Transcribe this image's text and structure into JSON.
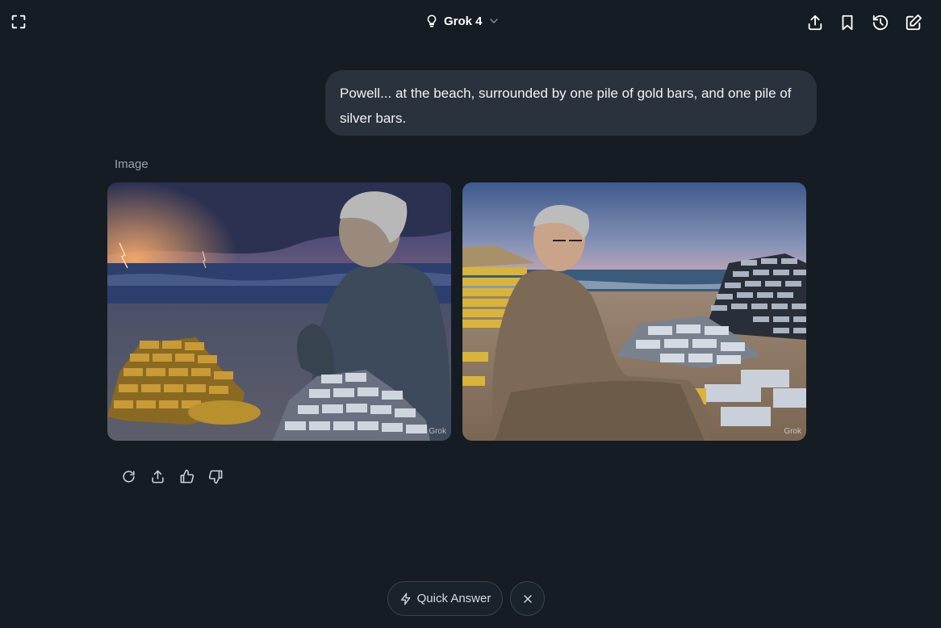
{
  "header": {
    "model_name": "Grok 4"
  },
  "conversation": {
    "user_message": "Powell... at the beach, surrounded by one pile of gold bars, and one pile of silver bars.",
    "response_label": "Image",
    "images": [
      {
        "watermark": "Grok"
      },
      {
        "watermark": "Grok"
      }
    ]
  },
  "bottom_bar": {
    "quick_answer_label": "Quick Answer"
  },
  "icons": {
    "expand": "expand-icon",
    "model": "lightbulb-icon",
    "share": "share-icon",
    "bookmark": "bookmark-icon",
    "history": "history-icon",
    "edit": "edit-icon",
    "regenerate": "refresh-icon",
    "thumbs_up": "thumbs-up-icon",
    "thumbs_down": "thumbs-down-icon",
    "lightning": "lightning-icon",
    "close": "close-icon"
  },
  "colors": {
    "background": "#151c24",
    "bubble": "#2a333d",
    "muted_text": "#9aa4ad"
  }
}
